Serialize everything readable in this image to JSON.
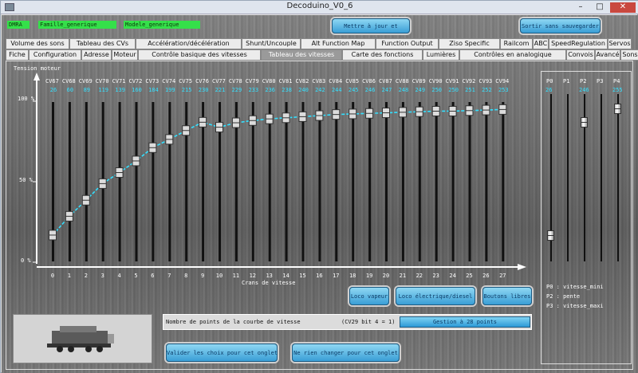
{
  "window": {
    "title": "Decoduino_V0_6",
    "min": "–",
    "max": "□",
    "close": "✕"
  },
  "badges": [
    "DMRA",
    "Famille_generique",
    "Modele_generique"
  ],
  "top_buttons": {
    "update": "Mettre à jour et sortir",
    "exit": "Sortir sans sauvegarder"
  },
  "tabs_row1": [
    "Volume des sons",
    "Tableau des CVs",
    "Accélération/décélération",
    "Shunt/Uncouple",
    "Alt Function Map",
    "Function Output",
    "Ziso Specific",
    "Railcom",
    "ABC",
    "SpeedRegulation",
    "Servos"
  ],
  "tabs_row2": [
    "Fiche",
    "Configuration",
    "Adresse",
    "Moteur",
    "Contrôle basique des vitesses",
    "Tableau des vitesses",
    "Carte des fonctions",
    "Lumières",
    "Contrôles en analogique",
    "Convois",
    "Avancé",
    "Sons"
  ],
  "active_tab": "Tableau des vitesses",
  "graph": {
    "y_title": "Tension moteur",
    "x_title": "Crans de vitesse",
    "y_ticks": [
      "100 %",
      "50 %",
      "0 %"
    ],
    "x_ticks": [
      "0",
      "1",
      "2",
      "3",
      "4",
      "5",
      "6",
      "7",
      "8",
      "9",
      "10",
      "11",
      "12",
      "13",
      "14",
      "15",
      "16",
      "17",
      "18",
      "19",
      "20",
      "21",
      "22",
      "23",
      "24",
      "25",
      "26",
      "27"
    ],
    "cv_names": [
      "CV67",
      "CV68",
      "CV69",
      "CV70",
      "CV71",
      "CV72",
      "CV73",
      "CV74",
      "CV75",
      "CV76",
      "CV77",
      "CV78",
      "CV79",
      "CV80",
      "CV81",
      "CV82",
      "CV83",
      "CV84",
      "CV85",
      "CV86",
      "CV87",
      "CV88",
      "CV89",
      "CV90",
      "CV91",
      "CV92",
      "CV93",
      "CV94"
    ],
    "cv_values": [
      "26",
      "60",
      "89",
      "119",
      "139",
      "160",
      "184",
      "199",
      "215",
      "230",
      "221",
      "229",
      "233",
      "236",
      "238",
      "240",
      "242",
      "244",
      "245",
      "246",
      "247",
      "248",
      "249",
      "250",
      "250",
      "251",
      "252",
      "253"
    ]
  },
  "chart_data": {
    "type": "line",
    "title": "",
    "xlabel": "Crans de vitesse",
    "ylabel": "Tension moteur",
    "ylim": [
      0,
      255
    ],
    "x": [
      0,
      1,
      2,
      3,
      4,
      5,
      6,
      7,
      8,
      9,
      10,
      11,
      12,
      13,
      14,
      15,
      16,
      17,
      18,
      19,
      20,
      21,
      22,
      23,
      24,
      25,
      26,
      27
    ],
    "series": [
      {
        "values": [
          26,
          60,
          89,
          119,
          139,
          160,
          184,
          199,
          215,
          230,
          221,
          229,
          233,
          236,
          238,
          240,
          242,
          244,
          245,
          246,
          247,
          248,
          249,
          250,
          250,
          251,
          252,
          253
        ]
      }
    ]
  },
  "params": {
    "names": [
      "P0",
      "P1",
      "P2",
      "P3",
      "P4"
    ],
    "values": [
      "26",
      "",
      "246",
      "",
      "255"
    ],
    "levels": [
      26,
      null,
      230,
      null,
      255
    ],
    "legend": [
      "P0 : vitesse_mini",
      "P2 : pente",
      "P3 : vitesse_maxi"
    ]
  },
  "buttons": {
    "steam": "Loco vapeur",
    "electric": "Loco électrique/diesel",
    "free": "Boutons libres",
    "validate": "Valider les choix pour cet onglet",
    "nochange": "Ne rien changer pour cet onglet"
  },
  "info": {
    "label": "Nombre de points de la courbe de vitesse",
    "note": "(CV29 bit 4 = 1)",
    "mode": "Gestion à 28 points"
  },
  "colors": {
    "accent": "#34e0ff",
    "badge": "#35e04a",
    "button": "#3a9ed6"
  }
}
